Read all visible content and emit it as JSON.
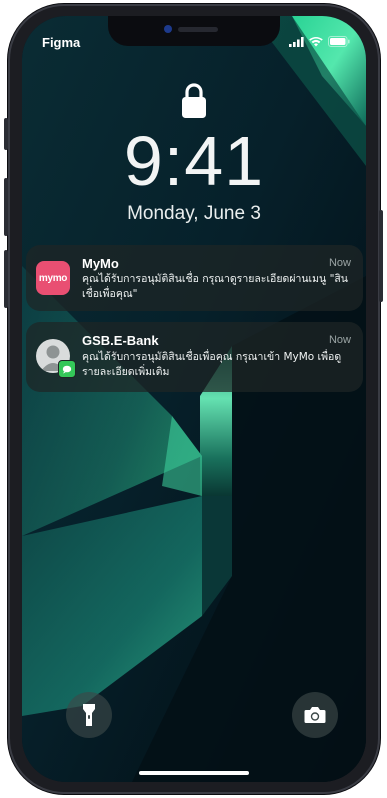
{
  "status_bar": {
    "carrier": "Figma",
    "icons": [
      "signal-icon",
      "wifi-icon",
      "battery-icon"
    ]
  },
  "lock_screen": {
    "lock_icon": "lock-icon",
    "time": "9:41",
    "date": "Monday, June 3"
  },
  "notifications": [
    {
      "app": "MyMo",
      "time": "Now",
      "icon": "mymo-app-icon",
      "icon_text": "mymo",
      "icon_color": "#e94f72",
      "message": "คุณได้รับการอนุมัติสินเชื่อ กรุณาดูรายละเอียดผ่านเมนู \"สินเชื่อเพื่อคุณ\""
    },
    {
      "app": "GSB.E-Bank",
      "time": "Now",
      "icon": "contact-avatar-icon",
      "message": "คุณได้รับการอนุมัติสินเชื่อเพื่อคุณ กรุณาเข้า MyMo เพื่อดูรายละเอียดเพิ่มเติม"
    }
  ],
  "quick_actions": {
    "flashlight": "flashlight-icon",
    "camera": "camera-icon"
  },
  "colors": {
    "accent_green": "#4cf0a8",
    "wallpaper_dark": "#04121a"
  }
}
